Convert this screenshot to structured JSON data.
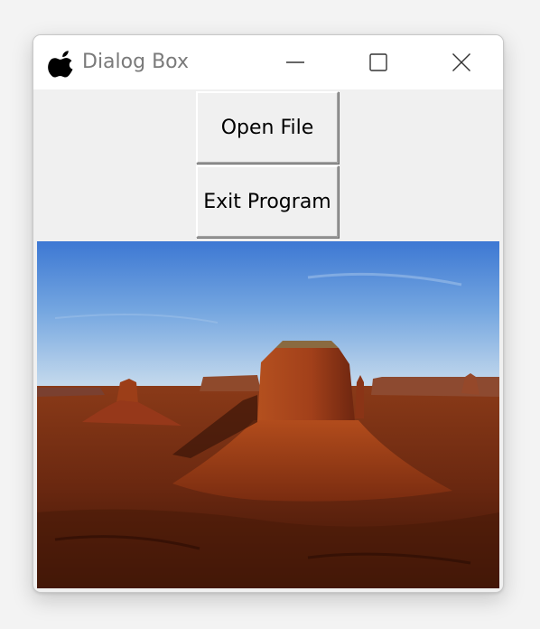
{
  "window": {
    "title": "Dialog Box",
    "app_icon": "apple-icon"
  },
  "titlebar_controls": {
    "minimize_icon": "minimize-icon",
    "maximize_icon": "maximize-icon",
    "close_icon": "close-icon"
  },
  "buttons": {
    "open_file": "Open File",
    "exit_program": "Exit Program"
  },
  "image": {
    "subject": "desert-mesa-landscape"
  },
  "colors": {
    "sky_top": "#3f7fd6",
    "sky_bottom": "#bcd7ee",
    "rock": "#a3401a",
    "ground": "#5a200d"
  }
}
